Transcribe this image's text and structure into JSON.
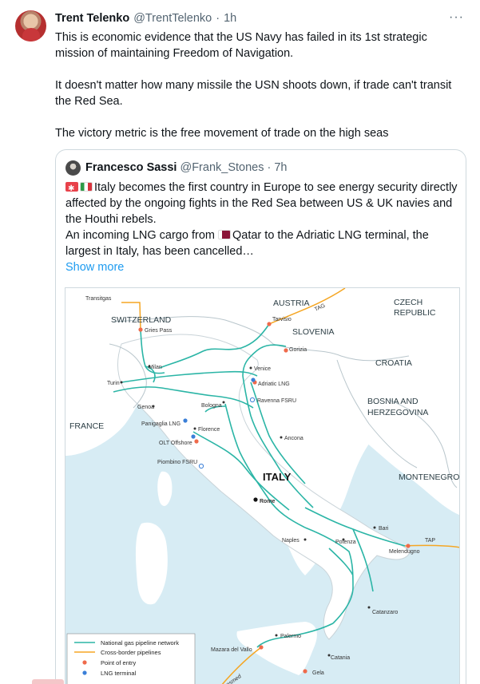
{
  "tweet": {
    "author_name": "Trent Telenko",
    "author_handle": "@TrentTelenko",
    "separator": "·",
    "time": "1h",
    "more_label": "···",
    "text": [
      "This is economic evidence that the US Navy has failed in its 1st strategic mission of maintaining Freedom of Navigation.",
      "It doesn't matter how many missile the USN shoots down, if trade can't transit the Red Sea.",
      "The victory metric is the free movement of trade on the high seas"
    ]
  },
  "quote": {
    "author_name": "Francesco Sassi",
    "author_handle": "@Frank_Stones",
    "separator": "·",
    "time": "7h",
    "line1": "Italy becomes the first country in Europe to see energy security directly affected by the ongoing fights in the Red Sea between US & UK navies and the Houthi rebels.",
    "line2_a": "An incoming LNG cargo from ",
    "line2_b": "Qatar to the Adriatic LNG terminal, the largest in Italy, has been cancelled…",
    "show_more": "Show more"
  },
  "map": {
    "colors": {
      "sea": "#d7ecf4",
      "land": "#ffffff",
      "pipeline": "#2bb5a6",
      "cross_border": "#f5a623",
      "entry": "#ef6a4b",
      "lng": "#3b7fd8",
      "border": "#b9c6cc"
    },
    "countries": [
      "AUSTRIA",
      "CZECH",
      "REPUBLIC",
      "SWITZERLAND",
      "SLOVENIA",
      "CROATIA",
      "BOSNIA AND",
      "HERZEGOVINA",
      "FRANCE",
      "ITALY",
      "MONTENEGRO"
    ],
    "labels": {
      "transitgas": "Transitgas",
      "tag": "TAG",
      "gries": "Gries Pass",
      "tarvisio": "Tarvisio",
      "gorizia": "Gorizia",
      "milan": "Milan",
      "venice": "Venice",
      "adriatic": "Adriatic LNG",
      "turin": "Turin",
      "ravenna": "Ravenna FSRU",
      "bologna": "Bologna",
      "genoa": "Genoa",
      "panigaglia": "Panigaglia LNG",
      "florence": "Florence",
      "ancona": "Ancona",
      "olt": "OLT Offshore",
      "piombino": "Piombino FSRU",
      "rome": "Rome",
      "bari": "Bari",
      "tap": "TAP",
      "melendugno": "Melendugno",
      "naples": "Naples",
      "potenza": "Potenza",
      "catanzaro": "Catanzaro",
      "palermo": "Palermo",
      "mazara": "Mazara del Vallo",
      "catania": "Catania",
      "gela": "Gela",
      "transmed": "Transmed"
    },
    "legend": [
      "National gas pipeline network",
      "Cross-border pipelines",
      "Point of entry",
      "LNG terminal"
    ]
  }
}
